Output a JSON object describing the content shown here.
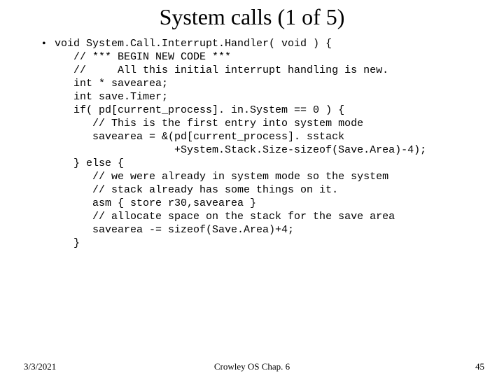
{
  "title": "System calls (1 of 5)",
  "bullet": "•",
  "code": "void System.Call.Interrupt.Handler( void ) {\n   // *** BEGIN NEW CODE ***\n   //     All this initial interrupt handling is new.\n   int * savearea;\n   int save.Timer;\n   if( pd[current_process]. in.System == 0 ) {\n      // This is the first entry into system mode\n      savearea = &(pd[current_process]. sstack\n                   +System.Stack.Size-sizeof(Save.Area)-4);\n   } else {\n      // we were already in system mode so the system\n      // stack already has some things on it.\n      asm { store r30,savearea }\n      // allocate space on the stack for the save area\n      savearea -= sizeof(Save.Area)+4;\n   }",
  "footer": {
    "left": "3/3/2021",
    "center": "Crowley    OS     Chap. 6",
    "right": "45"
  }
}
